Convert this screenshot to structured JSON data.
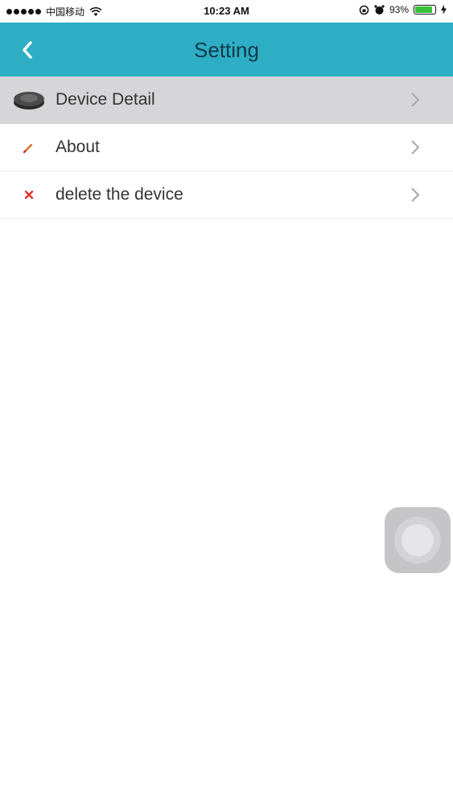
{
  "status_bar": {
    "carrier": "中国移动",
    "time": "10:23 AM",
    "battery_percent": "93%",
    "battery_level": 0.93,
    "battery_color": "#36c23a"
  },
  "nav": {
    "title": "Setting",
    "back_icon": "chevron-left-icon",
    "background": "#2eaec4"
  },
  "settings": {
    "items": [
      {
        "label": "Device Detail",
        "icon": "robot-vacuum-icon",
        "highlighted": true
      },
      {
        "label": "About",
        "icon": "pencil-icon",
        "highlighted": false
      },
      {
        "label": "delete the device",
        "icon": "x-icon",
        "highlighted": false
      }
    ]
  },
  "assistive_touch": {
    "icon": "assistive-touch-icon"
  }
}
